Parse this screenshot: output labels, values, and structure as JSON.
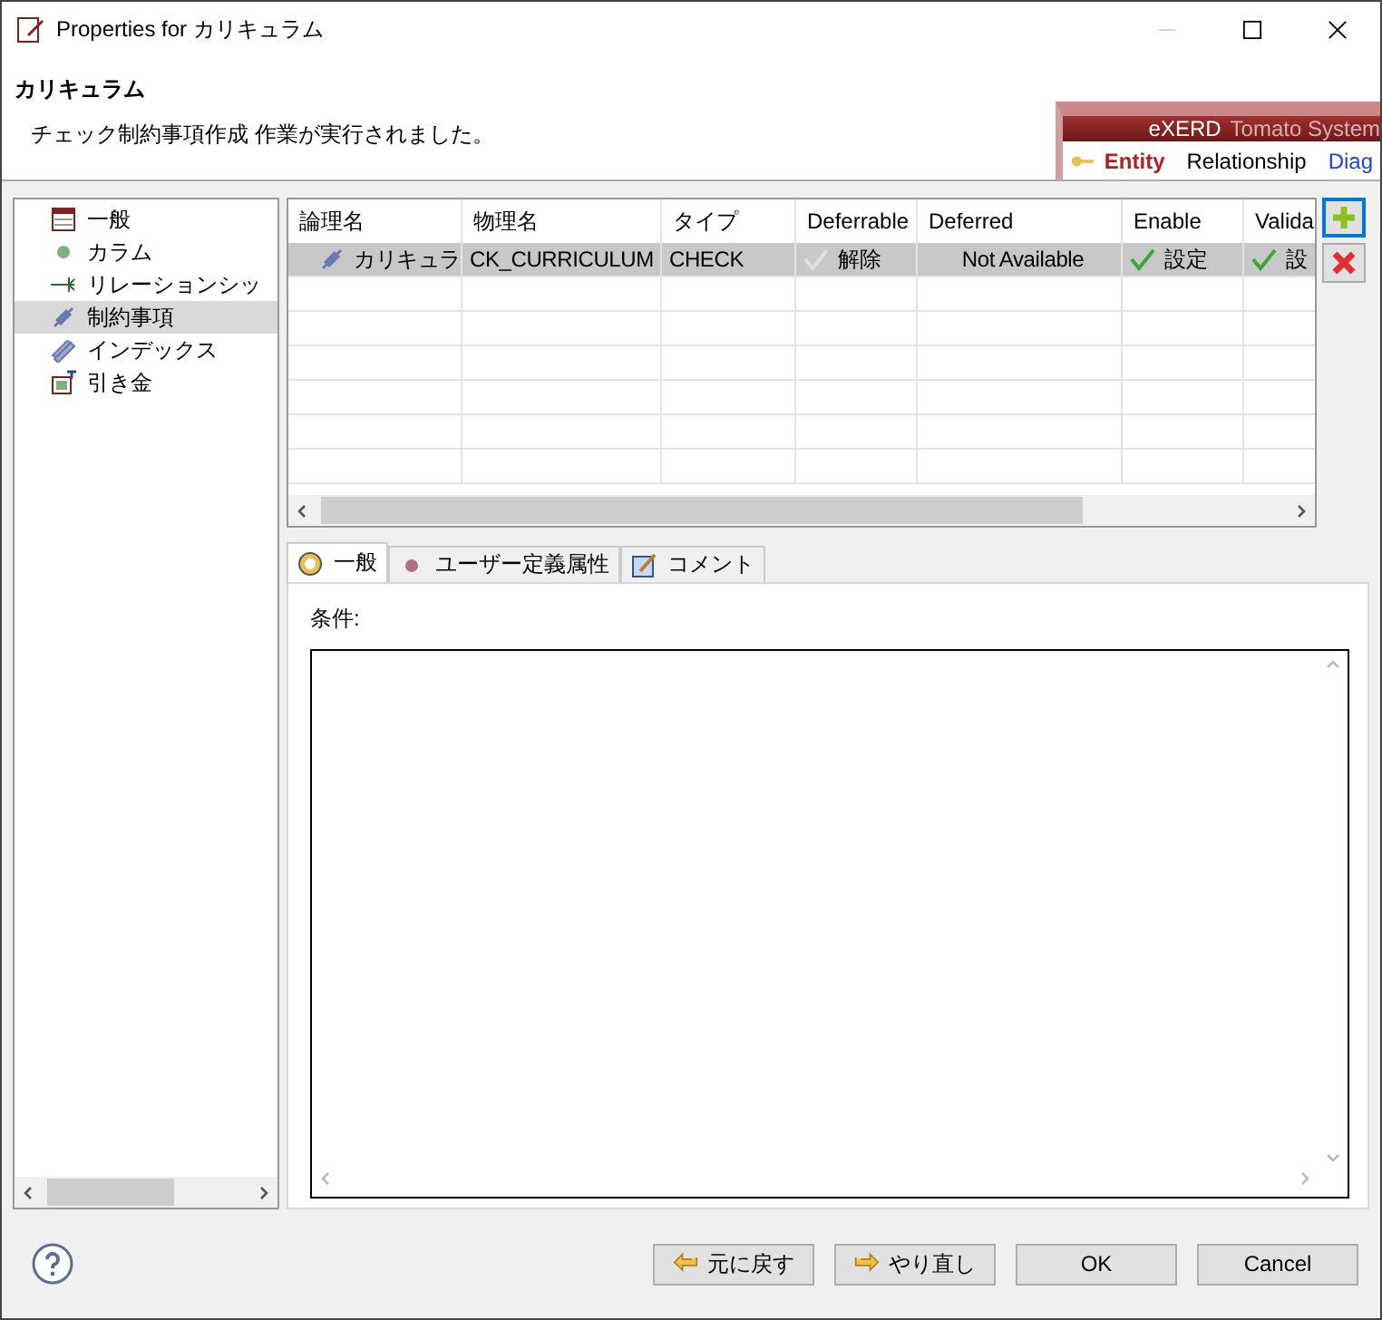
{
  "window": {
    "title": "Properties for カリキュラム"
  },
  "header": {
    "title": "カリキュラム",
    "message": "チェック制約事項作成 作業が実行されました。"
  },
  "banner": {
    "brand": "eXERD",
    "product": "Tomato System",
    "tabs": [
      {
        "label": "Entity",
        "selected": true
      },
      {
        "label": "Relationship",
        "selected": false
      },
      {
        "label": "Diag",
        "selected": false
      }
    ]
  },
  "sidebar": {
    "items": [
      {
        "label": "一般",
        "kind": "table",
        "selected": false
      },
      {
        "label": "カラム",
        "kind": "column",
        "selected": false
      },
      {
        "label": "リレーションシッ",
        "kind": "relation",
        "selected": false
      },
      {
        "label": "制約事項",
        "kind": "constraint",
        "selected": true
      },
      {
        "label": "インデックス",
        "kind": "index",
        "selected": false
      },
      {
        "label": "引き金",
        "kind": "trigger",
        "selected": false
      }
    ]
  },
  "table": {
    "columns": [
      "論理名",
      "物理名",
      "タイプ",
      "Deferrable",
      "Deferred",
      "Enable",
      "Valida"
    ],
    "rows": [
      {
        "selected": true,
        "cells": [
          {
            "kind": "icon_text",
            "text": "カリキュラ"
          },
          {
            "kind": "text",
            "text": "CK_CURRICULUM"
          },
          {
            "kind": "text",
            "text": "CHECK"
          },
          {
            "kind": "check",
            "text": "解除",
            "checked": false
          },
          {
            "kind": "center",
            "text": "Not Available"
          },
          {
            "kind": "check",
            "text": "設定",
            "checked": true
          },
          {
            "kind": "check",
            "text": "設",
            "checked": true
          }
        ]
      }
    ]
  },
  "tabs": [
    {
      "label": "一般",
      "kind": "general",
      "selected": true
    },
    {
      "label": "ユーザー定義属性",
      "kind": "attribute",
      "selected": false
    },
    {
      "label": "コメント",
      "kind": "comment",
      "selected": false
    }
  ],
  "condition": {
    "label": "条件:"
  },
  "buttons": [
    {
      "label": "元に戻す",
      "kind": "undo"
    },
    {
      "label": "やり直し",
      "kind": "redo"
    },
    {
      "label": "OK",
      "kind": "plain"
    },
    {
      "label": "Cancel",
      "kind": "plain"
    }
  ]
}
